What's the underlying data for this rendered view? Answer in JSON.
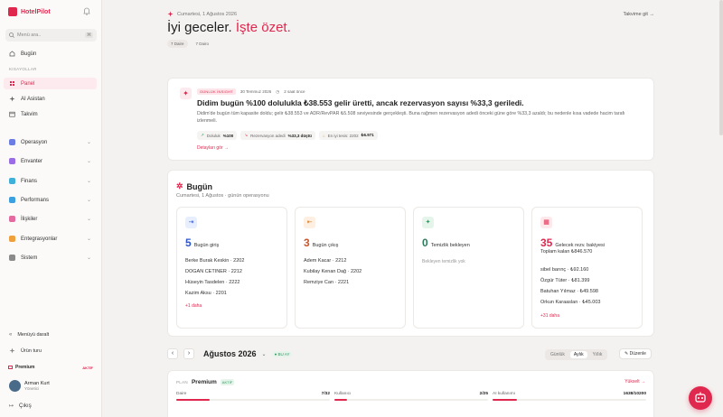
{
  "brand": {
    "name": "HotelPilot"
  },
  "search": {
    "placeholder": "Menü ara..",
    "shortcut": "⌘"
  },
  "sidebar": {
    "top_item": "Bugün",
    "shortcuts_label": "KISAYOLLAR",
    "shortcuts": [
      "Panel",
      "AI Asistan",
      "Takvim"
    ],
    "groups": [
      "Operasyon",
      "Envanter",
      "Finans",
      "Performans",
      "İlişkiler",
      "Entegrasyonlar",
      "Sistem"
    ],
    "collapse": "Menüyü daralt",
    "tour": "Ürün turu",
    "premium": {
      "label": "Premium",
      "tag": "AKTİF"
    },
    "user": {
      "name": "Arman Kurt",
      "role": "Yönetici"
    },
    "logout": "Çıkış"
  },
  "header": {
    "date": "Cumartesi, 1 Ağustos 2026",
    "greeting": "İyi geceler.",
    "greeting_accent": "İşte özet.",
    "chip_rooms": "7 Daire",
    "chip_plain": "7 Dairo",
    "calendar_link": "Takvime git"
  },
  "insight": {
    "badge": "GÜNLÜK İNSIGHT",
    "date": "30 Temmuz 2026",
    "age": "2 saat önce",
    "title": "Didim bugün %100 dolulukla ₺38.553 gelir üretti, ancak rezervasyon sayısı %33,3 geriledi.",
    "body": "Didim'de bugün tüm kapasite doldu; gelir ₺38.553 ve ADR/RevPAR ₺5.508 seviyesinde gerçekleşti. Buna rağmen rezervasyon adedi önceki güne göre %33,3 azaldı; bu nedenle kısa vadede hacim tarafı izlenmeli.",
    "metrics": [
      {
        "label": "Doluluk",
        "value": "%100"
      },
      {
        "label": "Rezervasyon adedi",
        "value": "%33,3 düştü"
      },
      {
        "label": "En iyi tesis: 2202",
        "value": "₺6.971"
      }
    ],
    "link": "Detayları gör"
  },
  "today": {
    "title": "Bugün",
    "subtitle": "Cumartesi, 1 Ağustos · günün operasyonu",
    "checkin": {
      "count": "5",
      "label": "Bugün giriş",
      "list": [
        "Berke Burak Keskin · 2202",
        "DOGAN CETINER · 2212",
        "Hüseyin Tasdelen · 2222",
        "Kazim Aksu · 2201"
      ],
      "more": "+1 daha"
    },
    "checkout": {
      "count": "3",
      "label": "Bugün çıkış",
      "list": [
        "Adem Kacar · 2212",
        "Kubilay Kenan Dağ · 2202",
        "Remziye Can · 2221"
      ]
    },
    "cleaning": {
      "count": "0",
      "label": "Temizlik bekleyen",
      "empty": "Bekleyen temizlik yok"
    },
    "future": {
      "count": "35",
      "label": "Gelecek rezv. bakiyesi",
      "total": "Toplam kalan ₺846.570",
      "list": [
        "sibel barınç · ₺92.160",
        "Özgür Tüter · ₺81.399",
        "Batuhan Yılmaz · ₺49.598",
        "Orkun Karaaslan · ₺45.003"
      ],
      "more": "+31 daha"
    }
  },
  "calendar": {
    "month": "Ağustos 2026",
    "live": "BU AY",
    "views": [
      "Günlük",
      "Aylık",
      "Yıllık"
    ],
    "active_view": "Aylık",
    "edit": "Düzenle"
  },
  "plan": {
    "label": "PLAN",
    "name": "Premium",
    "tag": "AKTİF",
    "renew": "Yükselt",
    "usage": [
      {
        "label": "Daire",
        "value": "7/32",
        "fraction": 0.22
      },
      {
        "label": "Kullanıcı",
        "value": "2/25",
        "fraction": 0.08
      },
      {
        "label": "AI kullanımı",
        "value": "1638/10200",
        "fraction": 0.16
      }
    ]
  },
  "colors": {
    "accent": "#e0284f",
    "success": "#2b9a5c"
  }
}
